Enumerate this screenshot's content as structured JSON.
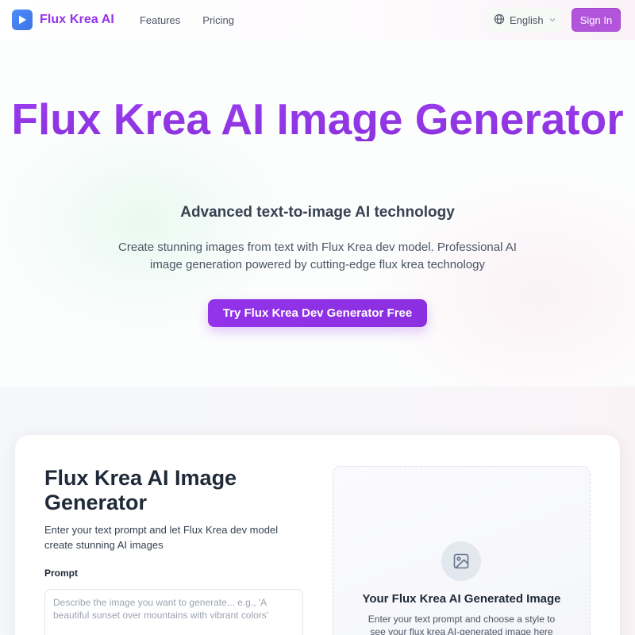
{
  "header": {
    "logo_text": "Flux Krea AI",
    "logo_icon": "play-icon",
    "nav": [
      {
        "label": "Features"
      },
      {
        "label": "Pricing"
      }
    ],
    "language": {
      "selected": "English",
      "icon": "globe-icon",
      "chevron": "chevron-down-icon"
    },
    "signin_label": "Sign In",
    "brand_color": "#9333ea"
  },
  "hero": {
    "title": "Flux Krea AI Image Generator",
    "subtitle": "Advanced text-to-image AI technology",
    "description": "Create stunning images from text with Flux Krea dev model. Professional AI image generation powered by cutting-edge flux krea technology",
    "cta_label": "Try Flux Krea Dev Generator Free"
  },
  "generator": {
    "title": "Flux Krea AI Image Generator",
    "description": "Enter your text prompt and let Flux Krea dev model create stunning AI images",
    "prompt_label": "Prompt",
    "prompt_value": "",
    "prompt_placeholder": "Describe the image you want to generate... e.g., 'A beautiful sunset over mountains with vibrant colors'",
    "preview": {
      "icon": "image-icon",
      "title": "Your Flux Krea AI Generated Image",
      "description": "Enter your text prompt and choose a style to see your flux krea AI-generated image here"
    }
  }
}
